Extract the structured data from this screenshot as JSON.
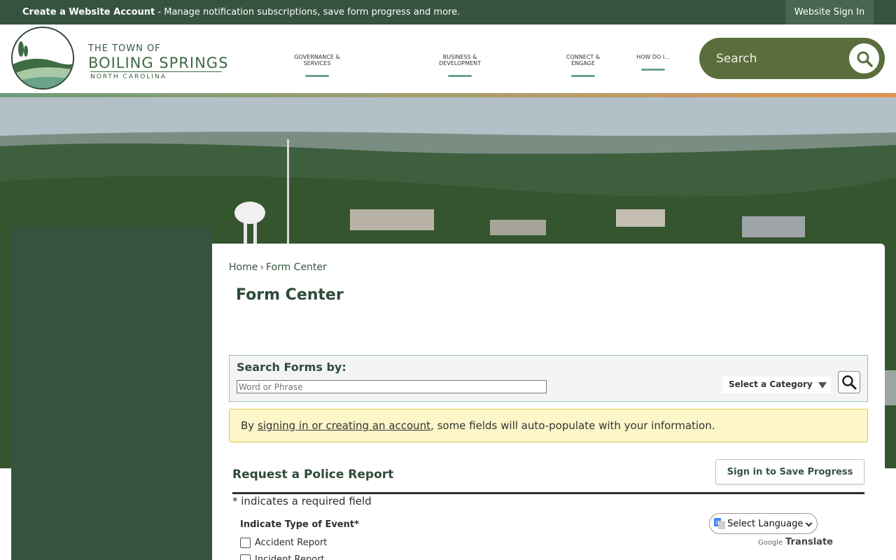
{
  "topbar": {
    "create_account": "Create a Website Account",
    "message": " - Manage notification subscriptions, save form progress and more.",
    "sign_in": "Website Sign In"
  },
  "logo": {
    "line1": "THE TOWN OF",
    "line2": "BOILING SPRINGS",
    "line3": "NORTH CAROLINA"
  },
  "nav": {
    "items": [
      {
        "label": "GOVERNANCE & SERVICES"
      },
      {
        "label": "BUSINESS & DEVELOPMENT"
      },
      {
        "label": "CONNECT & ENGAGE"
      },
      {
        "label": "HOW DO I..."
      }
    ]
  },
  "search": {
    "label": "Search"
  },
  "breadcrumb": {
    "home": "Home",
    "separator": "›",
    "current": "Form Center"
  },
  "page": {
    "title": "Form Center"
  },
  "search_forms": {
    "label": "Search Forms by:",
    "placeholder": "Word or Phrase",
    "category": "Select a Category"
  },
  "notice": {
    "prefix": "By ",
    "link": "signing in or creating an account",
    "suffix": ", some fields will auto-populate with your information."
  },
  "form": {
    "title": "Request a Police Report",
    "save_button": "Sign in to Save Progress",
    "required_note": "* indicates a required field",
    "question": "Indicate Type of Event*",
    "options": [
      {
        "label": "Accident Report"
      },
      {
        "label": "Incident Report"
      }
    ]
  },
  "translate": {
    "select_language": "Select Language",
    "powered_by": "Google",
    "translate": "Translate"
  },
  "colors": {
    "primary_green": "#35533f",
    "search_olive": "#5a6e3c",
    "notice_yellow": "#fdf6c9"
  }
}
